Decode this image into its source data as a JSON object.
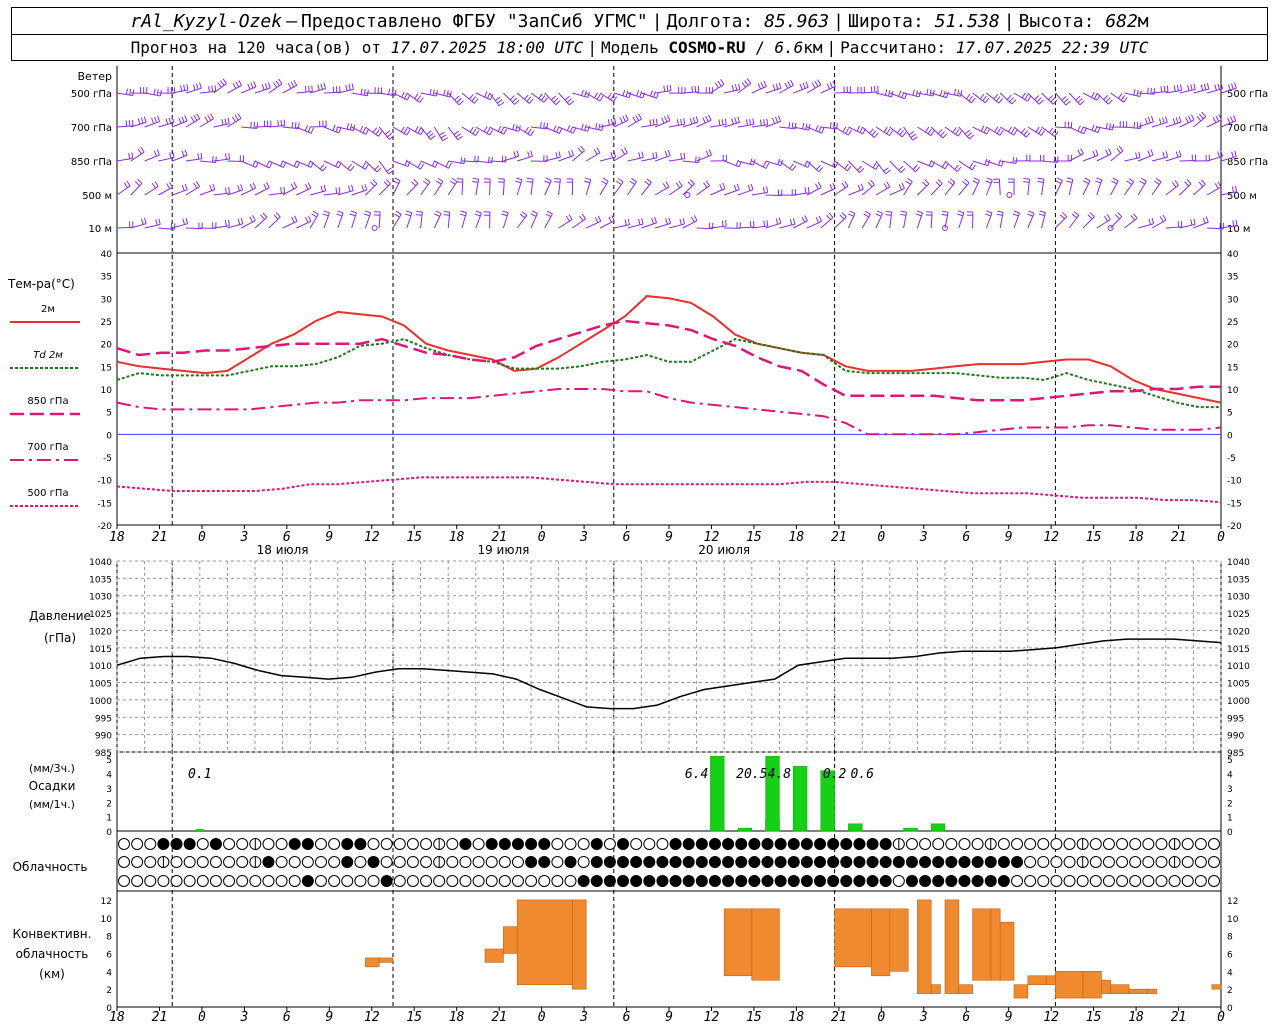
{
  "header": {
    "station": "rAl_Kyzyl-Ozek",
    "provider": "Предоставлено ФГБУ \"ЗапСиб УГМС\"",
    "lon_label": "Долгота:",
    "lon": "85.963",
    "lat_label": "Широта:",
    "lat": "51.538",
    "alt_label": "Высота:",
    "alt": "682",
    "alt_unit": "м",
    "forecast_label": "Прогноз на 120 часа(ов) от",
    "forecast_from": "17.07.2025 18:00 UTC",
    "model_label": "Модель",
    "model": "COSMO-RU",
    "model_res": "6.6",
    "model_res_unit": "км",
    "calc_label": "Рассчитано:",
    "calc_time": "17.07.2025 22:39 UTC"
  },
  "colors": {
    "wind": "#8b2be2",
    "t2m": "#e8302c",
    "td": "#1a7a1a",
    "t850": "#e0157a",
    "t700": "#e0157a",
    "t500": "#e0157a",
    "pressure": "#000000",
    "precip": "#16d016",
    "conv": "#f08a30",
    "zero_line": "#3d3dff"
  },
  "wind_panel": {
    "title": "Ветер",
    "levels": [
      "500 гПа",
      "700 гПа",
      "850 гПа",
      "500 м",
      "10 м"
    ]
  },
  "temp_panel": {
    "title": "Тем-ра(°C)",
    "legend": [
      {
        "label": "2м",
        "key": "t2m"
      },
      {
        "label": "Td  2м",
        "key": "td"
      },
      {
        "label": "850 гПа",
        "key": "t850"
      },
      {
        "label": "700 гПа",
        "key": "t700"
      },
      {
        "label": "500 гПа",
        "key": "t500"
      }
    ],
    "ylim": [
      -20,
      40
    ],
    "yticks": [
      "40",
      "35",
      "30",
      "25",
      "20",
      "15",
      "10",
      "5",
      "0",
      "-5",
      "-10",
      "-15",
      "-20"
    ]
  },
  "time_axis": {
    "hour_labels": [
      "18",
      "21",
      "0",
      "3",
      "6",
      "9",
      "12",
      "15",
      "18",
      "21",
      "0",
      "3",
      "6",
      "9",
      "12",
      "15",
      "18",
      "21",
      "0",
      "3",
      "6",
      "9",
      "12",
      "15",
      "18",
      "21",
      "0"
    ],
    "days": [
      "18 июля",
      "19 июля",
      "20 июля"
    ]
  },
  "pressure_panel": {
    "title": "Давление",
    "unit": "(гПа)",
    "ylim": [
      985,
      1040
    ],
    "yticks": [
      "1040",
      "1035",
      "1030",
      "1025",
      "1020",
      "1015",
      "1010",
      "1005",
      "1000",
      "995",
      "990",
      "985"
    ]
  },
  "precip_panel": {
    "unit_3h": "(мм/3ч.)",
    "title": "Осадки",
    "unit_1h": "(мм/1ч.)",
    "yticks": [
      "5",
      "4",
      "3",
      "2",
      "1",
      "0"
    ],
    "totals": [
      {
        "hour": 9,
        "text": "0.1"
      },
      {
        "hour": 63,
        "text": "6.4"
      },
      {
        "hour": 69,
        "text": "20.5"
      },
      {
        "hour": 72,
        "text": "4.8"
      },
      {
        "hour": 78,
        "text": "0.2"
      },
      {
        "hour": 81,
        "text": "0.6"
      }
    ]
  },
  "cloud_panel": {
    "title": "Облачность"
  },
  "conv_panel": {
    "title_1": "Конвективн.",
    "title_2": "облачность",
    "unit": "(км)",
    "yticks": [
      "12",
      "10",
      "8",
      "6",
      "4",
      "2",
      "0"
    ]
  },
  "chart_data": {
    "type": "line",
    "x_hours_from": "17.07.2025 18:00 UTC",
    "x_hours": [
      0,
      3,
      6,
      9,
      12,
      15,
      18,
      21,
      24,
      27,
      30,
      33,
      36,
      39,
      42,
      45,
      48,
      51,
      54,
      57,
      60,
      63,
      66,
      69,
      72,
      75,
      78,
      81,
      84,
      87,
      90,
      93,
      96,
      99,
      102,
      105,
      108,
      111,
      114,
      117,
      120
    ],
    "series": [
      {
        "name": "2м",
        "values": [
          16,
          15,
          14.5,
          14,
          13.5,
          14,
          17,
          20,
          22,
          25,
          27,
          26.5,
          26,
          24,
          20,
          18.5,
          17.5,
          16.5,
          14,
          14.5,
          17,
          20,
          23,
          26,
          30.5,
          30,
          29,
          26,
          22,
          20,
          19,
          18,
          17.5,
          15,
          14,
          14,
          14,
          14.5,
          15,
          15.5,
          15.5,
          15.5,
          16,
          16.5,
          16.5,
          15,
          12,
          10,
          9,
          8,
          7
        ]
      },
      {
        "name": "Td  2м",
        "values": [
          12,
          13.5,
          13,
          13,
          13,
          13,
          14,
          15,
          15,
          15.5,
          17,
          19.5,
          20,
          21,
          19,
          17.5,
          16.5,
          16,
          14.5,
          14.5,
          14.5,
          15,
          16,
          16.5,
          17.5,
          16,
          16,
          18.5,
          21,
          20,
          19,
          18,
          17.5,
          14,
          13.5,
          13.5,
          13.5,
          13.5,
          13.5,
          13,
          12.5,
          12.5,
          12,
          13.5,
          12,
          11,
          10,
          8.5,
          7,
          6,
          6
        ]
      },
      {
        "name": "850 гПа",
        "values": [
          19,
          17.5,
          18,
          18,
          18.5,
          18.5,
          19,
          19.5,
          20,
          20,
          20,
          20,
          21,
          19.5,
          18,
          17.5,
          16.5,
          16,
          17,
          19.5,
          21,
          22.5,
          24,
          25,
          24.5,
          24,
          23,
          21,
          19.5,
          17,
          15,
          14,
          11,
          8.5,
          8.5,
          8.5,
          8.5,
          8.5,
          8,
          7.5,
          7.5,
          7.5,
          8,
          8.5,
          9,
          9.5,
          9.5,
          10,
          10,
          10.5,
          10.5
        ]
      },
      {
        "name": "700 гПа",
        "values": [
          7,
          6,
          5.5,
          5.5,
          5.5,
          5.5,
          5.5,
          6,
          6.5,
          7,
          7,
          7.5,
          7.5,
          7.5,
          8,
          8,
          8,
          8.5,
          9,
          9.5,
          10,
          10,
          10,
          9.5,
          9.5,
          8,
          7,
          6.5,
          6,
          5.5,
          5,
          4.5,
          4,
          2.5,
          0,
          0,
          0,
          0,
          0,
          0.5,
          1,
          1.5,
          1.5,
          1.5,
          2,
          2,
          1.5,
          1,
          1,
          1,
          1.5
        ]
      },
      {
        "name": "500 гПа",
        "values": [
          -11.5,
          -12,
          -12.5,
          -12.5,
          -12.5,
          -12.5,
          -12,
          -11,
          -11,
          -10.5,
          -10,
          -9.5,
          -9.5,
          -9.5,
          -9.5,
          -9.5,
          -10,
          -10.5,
          -11,
          -11,
          -11,
          -11,
          -11,
          -11,
          -11,
          -10.5,
          -10.5,
          -11,
          -11.5,
          -12,
          -12.5,
          -13,
          -13,
          -13,
          -13.5,
          -14,
          -14,
          -14,
          -14.5,
          -14.5,
          -15
        ]
      },
      {
        "name": "Давление",
        "values": [
          1010,
          1012,
          1012.5,
          1012.5,
          1012,
          1010.5,
          1008.5,
          1007,
          1006.5,
          1006,
          1006.5,
          1008,
          1009,
          1009,
          1008.5,
          1008,
          1007.5,
          1006,
          1003,
          1000.5,
          998,
          997.5,
          997.5,
          998.5,
          1001,
          1003,
          1004,
          1005,
          1006,
          1010,
          1011,
          1012,
          1012,
          1012,
          1012.5,
          1013.5,
          1014,
          1014,
          1014,
          1014.5,
          1015,
          1016,
          1017,
          1017.5,
          1017.5,
          1017.5,
          1017,
          1016.5
        ]
      }
    ],
    "precip_3h": [
      {
        "hour": 66,
        "value": 5.2,
        "total": "6.4"
      },
      {
        "hour": 69,
        "value": 0.2
      },
      {
        "hour": 72,
        "value": 0.8
      },
      {
        "hour": 72,
        "value": 5.2,
        "total": "20.5"
      },
      {
        "hour": 75,
        "value": 4.5
      },
      {
        "hour": 78,
        "value": 4.2,
        "total": "4.8"
      },
      {
        "hour": 81,
        "value": 0.5
      },
      {
        "hour": 87,
        "value": 0.2
      },
      {
        "hour": 90,
        "value": 0.5
      }
    ],
    "conv_clouds": [
      {
        "from": 27,
        "to": 28.5,
        "bottom": 4.5,
        "top": 5.5
      },
      {
        "from": 28.5,
        "to": 30,
        "bottom": 5,
        "top": 5.5
      },
      {
        "from": 40,
        "to": 42,
        "bottom": 5,
        "top": 6.5
      },
      {
        "from": 42,
        "to": 43.5,
        "bottom": 6,
        "top": 9
      },
      {
        "from": 43.5,
        "to": 49.5,
        "bottom": 2.5,
        "top": 12
      },
      {
        "from": 49.5,
        "to": 51,
        "bottom": 2,
        "top": 12
      },
      {
        "from": 66,
        "to": 69,
        "bottom": 3.5,
        "top": 11
      },
      {
        "from": 69,
        "to": 72,
        "bottom": 3,
        "top": 11
      },
      {
        "from": 78,
        "to": 82,
        "bottom": 4.5,
        "top": 11
      },
      {
        "from": 82,
        "to": 84,
        "bottom": 3.5,
        "top": 11
      },
      {
        "from": 84,
        "to": 86,
        "bottom": 4,
        "top": 11
      },
      {
        "from": 87,
        "to": 88.5,
        "bottom": 1.5,
        "top": 12
      },
      {
        "from": 88.5,
        "to": 89.5,
        "bottom": 1.5,
        "top": 2.5
      },
      {
        "from": 90,
        "to": 91.5,
        "bottom": 1.5,
        "top": 12
      },
      {
        "from": 91.5,
        "to": 93,
        "bottom": 1.5,
        "top": 2.5
      },
      {
        "from": 93,
        "to": 95,
        "bottom": 3,
        "top": 11
      },
      {
        "from": 95,
        "to": 96,
        "bottom": 3,
        "top": 11
      },
      {
        "from": 96,
        "to": 97.5,
        "bottom": 3,
        "top": 9.5
      },
      {
        "from": 97.5,
        "to": 99,
        "bottom": 1,
        "top": 2.5
      },
      {
        "from": 99,
        "to": 101,
        "bottom": 2.5,
        "top": 3.5
      },
      {
        "from": 101,
        "to": 102,
        "bottom": 2.5,
        "top": 3.5
      },
      {
        "from": 102,
        "to": 105,
        "bottom": 1,
        "top": 4
      },
      {
        "from": 105,
        "to": 107,
        "bottom": 1,
        "top": 4
      },
      {
        "from": 107,
        "to": 108,
        "bottom": 1.5,
        "top": 3
      },
      {
        "from": 108,
        "to": 110,
        "bottom": 1.5,
        "top": 2.5
      },
      {
        "from": 110,
        "to": 112,
        "bottom": 1.5,
        "top": 2
      },
      {
        "from": 112,
        "to": 113,
        "bottom": 1.5,
        "top": 2
      },
      {
        "from": 119,
        "to": 120,
        "bottom": 2,
        "top": 2.5
      }
    ],
    "cloud_low": "000111010000011001100000001011111000101000111111111111111110000000000000000000000000",
    "cloud_mid": "000000000001000001010000000000011010111111111111111111111111111111111000000000000000",
    "cloud_high": "000000000000001000001000000000000001111111111111111111111110111111110000000000000000"
  }
}
